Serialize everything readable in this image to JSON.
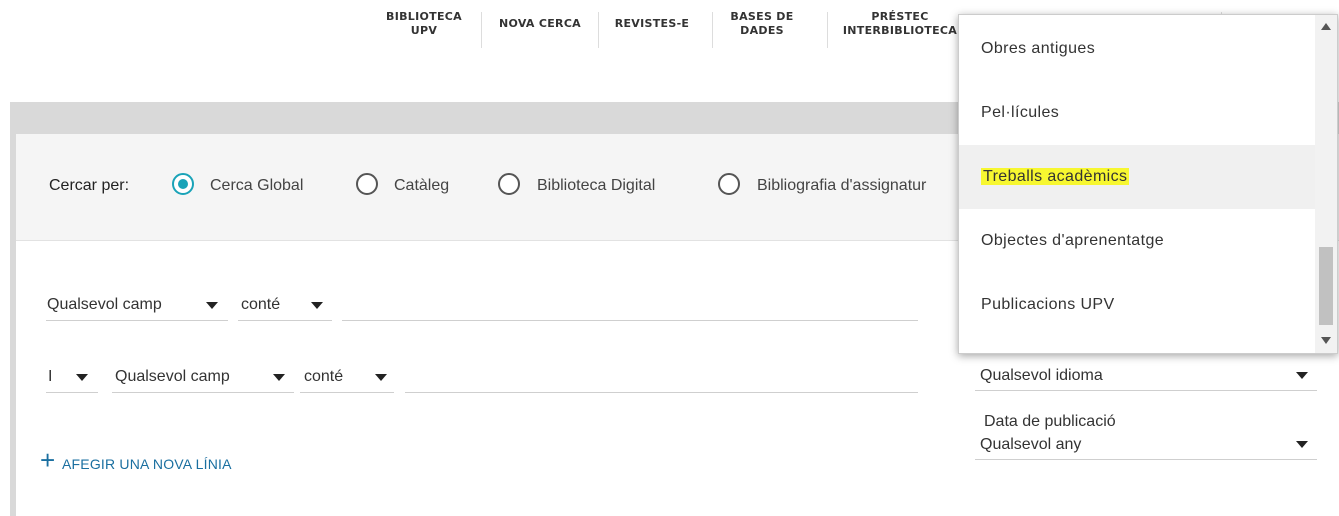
{
  "nav": {
    "biblioteca_upv": "BIBLIOTECA\nUPV",
    "nova_cerca": "NOVA CERCA",
    "revistes_e": "REVISTES-E",
    "bases_de_dades": "BASES DE\nDADES",
    "prestec": "PRÉSTEC\nINTERBIBLIOTECA"
  },
  "search_by": {
    "label": "Cercar per:",
    "options": [
      {
        "label": "Cerca Global",
        "checked": true
      },
      {
        "label": "Catàleg",
        "checked": false
      },
      {
        "label": "Biblioteca Digital",
        "checked": false
      },
      {
        "label": "Bibliografia d'assignatur",
        "checked": false
      }
    ]
  },
  "query_rows": [
    {
      "field": "Qualsevol camp",
      "operator": "conté"
    },
    {
      "boolean": "I",
      "field": "Qualsevol camp",
      "operator": "conté"
    }
  ],
  "add_line": "AFEGIR UNA NOVA LÍNIA",
  "filters": {
    "language": "Qualsevol idioma",
    "pub_date_label": "Data de publicació",
    "pub_date_value": "Qualsevol any"
  },
  "dropdown": {
    "items": [
      {
        "label": "Obres antigues"
      },
      {
        "label": "Pel·lícules"
      },
      {
        "label": "Treballs acadèmics",
        "highlighted": true
      },
      {
        "label": "Objectes d'aprenentatge"
      },
      {
        "label": "Publicacions UPV"
      }
    ]
  },
  "colors": {
    "accent": "#1aa3b8",
    "link": "#1a6fa0",
    "highlight": "#f7f730"
  }
}
